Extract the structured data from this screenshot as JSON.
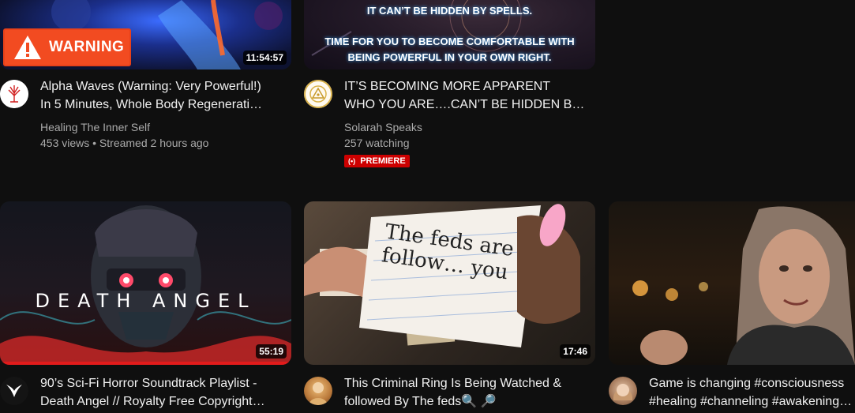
{
  "videos": [
    {
      "title_line1": "Alpha Waves (Warning: Very Powerful!)",
      "title_line2": "In 5 Minutes, Whole Body Regenerati…",
      "channel": "Healing The Inner Self",
      "meta": "453 views • Streamed 2 hours ago",
      "duration": "11:54:57",
      "badge_text": "WARNING",
      "thumb_icon": "warning-icon"
    },
    {
      "title_line1": "IT’S BECOMING MORE APPARENT",
      "title_line2": "WHO YOU ARE….CAN’T BE HIDDEN B…",
      "channel": "Solarah Speaks",
      "meta": "257 watching",
      "premiere_label": "PREMIERE",
      "thumb_line1": "IT CAN’T BE HIDDEN BY SPELLS.",
      "thumb_line2": "TIME FOR YOU TO BECOME COMFORTABLE WITH",
      "thumb_line3": "BEING POWERFUL IN YOUR OWN RIGHT."
    },
    {
      "title_line1": "90’s Sci-Fi Horror Soundtrack Playlist -",
      "title_line2": "Death Angel // Royalty Free Copyright…",
      "duration": "55:19",
      "thumb_text": "DEATH ANGEL"
    },
    {
      "title_line1": "This Criminal Ring Is Being Watched &",
      "title_line2": "followed By The feds🔍 🔎",
      "duration": "17:46",
      "card_text": "The feds are follow… you"
    },
    {
      "title_line1": "Game is changing #consciousness",
      "title_line2": "#healing #channeling #awakening…"
    }
  ],
  "colors": {
    "background": "#0f0f0f",
    "text_primary": "#f1f1f1",
    "text_secondary": "#aaaaaa",
    "premiere_red": "#cc0000",
    "warning_orange": "#f24b21"
  }
}
